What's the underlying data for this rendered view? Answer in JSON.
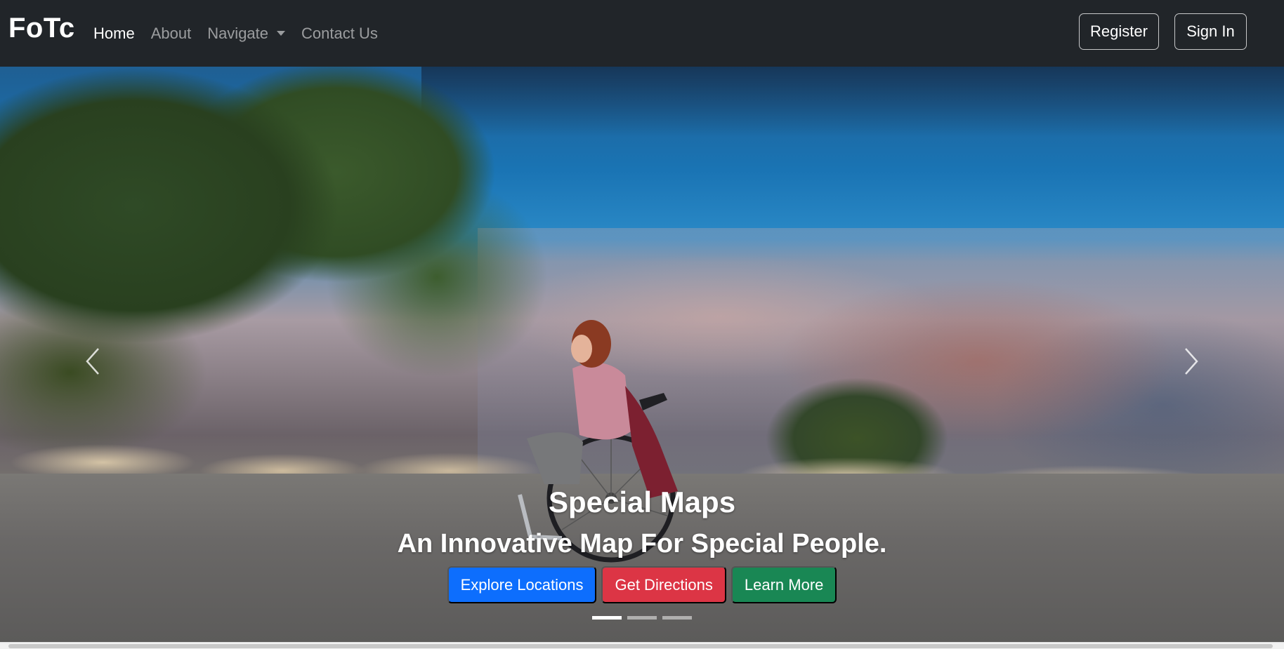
{
  "navbar": {
    "brand": "FoTc",
    "links": [
      {
        "label": "Home",
        "active": true
      },
      {
        "label": "About",
        "active": false
      },
      {
        "label": "Navigate",
        "active": false,
        "dropdown": true
      },
      {
        "label": "Contact Us",
        "active": false
      }
    ],
    "register_label": "Register",
    "signin_label": "Sign In"
  },
  "hero": {
    "title": "Special Maps",
    "subtitle": "An Innovative Map For Special People.",
    "buttons": [
      {
        "label": "Explore Locations",
        "color": "#0d6efd"
      },
      {
        "label": "Get Directions",
        "color": "#dc3545"
      },
      {
        "label": "Learn More",
        "color": "#198754"
      }
    ],
    "slide_count": 3,
    "active_slide": 1,
    "prev_icon": "chevron-left-icon",
    "next_icon": "chevron-right-icon"
  },
  "colors": {
    "navbar_bg": "#212529",
    "nav_active": "#ffffff",
    "nav_inactive": "rgba(255,255,255,0.55)"
  }
}
